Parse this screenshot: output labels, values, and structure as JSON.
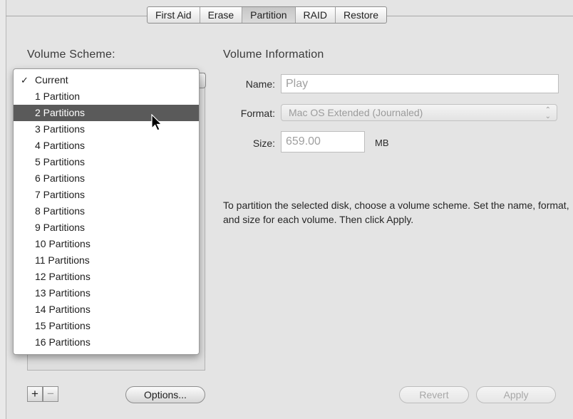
{
  "tabs": [
    {
      "label": "First Aid",
      "selected": false
    },
    {
      "label": "Erase",
      "selected": false
    },
    {
      "label": "Partition",
      "selected": true
    },
    {
      "label": "RAID",
      "selected": false
    },
    {
      "label": "Restore",
      "selected": false
    }
  ],
  "volume_scheme": {
    "title": "Volume Scheme:",
    "menu_items": [
      "Current",
      "1 Partition",
      "2 Partitions",
      "3 Partitions",
      "4 Partitions",
      "5 Partitions",
      "6 Partitions",
      "7 Partitions",
      "8 Partitions",
      "9 Partitions",
      "10 Partitions",
      "11 Partitions",
      "12 Partitions",
      "13 Partitions",
      "14 Partitions",
      "15 Partitions",
      "16 Partitions"
    ],
    "checked_item": "Current",
    "highlighted_item": "2 Partitions",
    "checkmark": "✓"
  },
  "volume_information": {
    "title": "Volume Information",
    "name_label": "Name:",
    "name_value": "Play",
    "format_label": "Format:",
    "format_value": "Mac OS Extended (Journaled)",
    "size_label": "Size:",
    "size_value": "659.00",
    "size_unit": "MB"
  },
  "help_text": "To partition the selected disk, choose a volume scheme. Set the name, format, and size for each volume. Then click Apply.",
  "buttons": {
    "add": "+",
    "remove": "−",
    "options": "Options...",
    "revert": "Revert",
    "apply": "Apply"
  },
  "colors": {
    "highlight": "#5a5a5a",
    "background": "#e4e4e4"
  },
  "icons": {
    "cursor": "arrow-cursor-icon",
    "select_arrows": "updown-arrows-icon"
  }
}
